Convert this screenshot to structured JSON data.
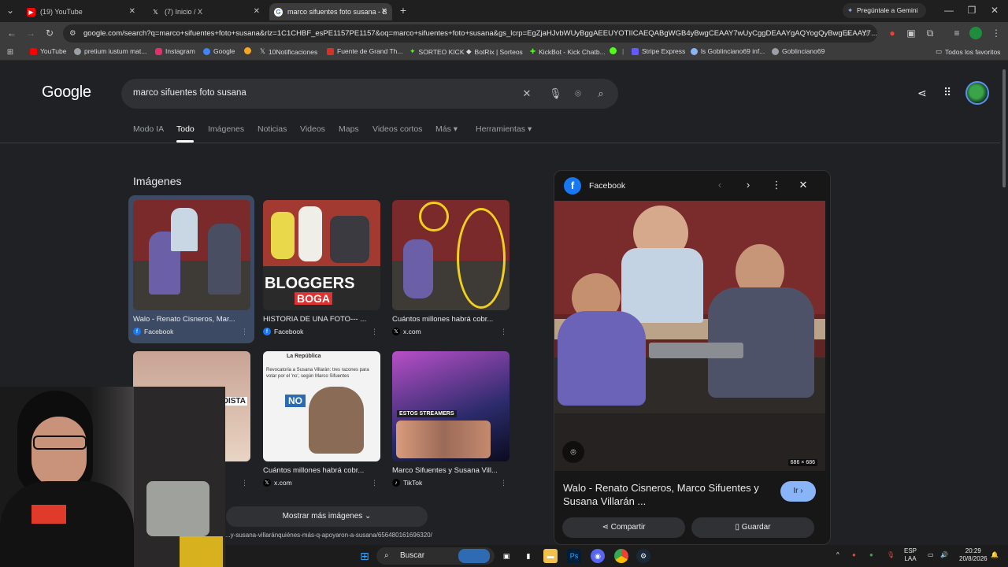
{
  "browser": {
    "tabs": [
      {
        "title": "(19) YouTube",
        "icon": "youtube-icon"
      },
      {
        "title": "(7) Inicio / X",
        "icon": "x-icon"
      },
      {
        "title": "marco sifuentes foto susana - B",
        "icon": "google-icon",
        "active": true
      }
    ],
    "gemini_button": "Pregúntale a Gemini",
    "url": "google.com/search?q=marco+sifuentes+foto+susana&rlz=1C1CHBF_esPE1157PE1157&oq=marco+sifuentes+foto+susana&gs_lcrp=EgZjaHJvbWUyBggAEEUYOTIICAEQABgWGB4yBwgCEAAY7wUyCggDEAAYgAQYogQyBwgEEAAY7...",
    "bookmarks": [
      {
        "label": "YouTube",
        "color": "#ff0000"
      },
      {
        "label": "pretium iustum mat...",
        "color": "#9aa0a6"
      },
      {
        "label": "Instagram",
        "color": "#e1306c"
      },
      {
        "label": "Google",
        "color": "#4285f4"
      },
      {
        "label": "",
        "color": "#f5a623"
      },
      {
        "label": "10Notificaciones",
        "color": "#e8eaed"
      },
      {
        "label": "Fuente de Grand Th...",
        "color": "#d93025"
      },
      {
        "label": "SORTEO KICK",
        "color": "#53fc18"
      },
      {
        "label": "BotRix | Sorteos",
        "color": "#e8eaed"
      },
      {
        "label": "KickBot - Kick Chatb...",
        "color": "#53fc18"
      },
      {
        "label": "",
        "color": "#53fc18"
      },
      {
        "label": "|",
        "color": "#3c3c3c"
      },
      {
        "label": "Stripe Express",
        "color": "#635bff"
      },
      {
        "label": "ls Goblinciano69 inf...",
        "color": "#8ab4f8"
      },
      {
        "label": "Goblinciano69",
        "color": "#9aa0a6"
      }
    ],
    "all_bookmarks": "Todos los favoritos"
  },
  "google": {
    "logo": "Google",
    "query": "marco sifuentes foto susana",
    "nav": [
      "Modo IA",
      "Todo",
      "Imágenes",
      "Noticias",
      "Videos",
      "Maps",
      "Videos cortos",
      "Más ▾",
      "Herramientas ▾"
    ],
    "active_nav": "Todo",
    "images_heading": "Imágenes",
    "results": [
      {
        "caption": "Walo - Renato Cisneros, Mar...",
        "source": "Facebook",
        "source_icon": "facebook-icon"
      },
      {
        "caption": "HISTORIA DE UNA FOTO--- ...",
        "source": "Facebook",
        "source_icon": "facebook-icon"
      },
      {
        "caption": "Cuántos millones habrá cobr...",
        "source": "x.com",
        "source_icon": "x-icon"
      },
      {
        "caption": "...CO...",
        "source": "",
        "source_icon": ""
      },
      {
        "caption": "Cuántos millones habrá cobr...",
        "source": "x.com",
        "source_icon": "x-icon"
      },
      {
        "caption": "Marco Sifuentes y Susana Vill...",
        "source": "TikTok",
        "source_icon": "tiktok-icon"
      }
    ],
    "thumb_text": {
      "bloggers": "BLOGGERS",
      "boga": "BOGA",
      "republica": "La República",
      "tweet": "Revocatoria a Susana Villarán: tres razones para votar por el 'no', según Marco Sifuentes",
      "no": "NO",
      "streamers": "ESTOS STREAMERS",
      "odista": "ODISTA"
    },
    "more_images": "Mostrar más imágenes",
    "status_url": "...y-susana-villaránquiénes-más-q-apoyaron-a-susana/656480161696320/"
  },
  "preview": {
    "source": "Facebook",
    "title": "Walo - Renato Cisneros, Marco Sifuentes y Susana Villarán ...",
    "dimensions": "686 × 686",
    "go_button": "Ir",
    "share_button": "Compartir",
    "save_button": "Guardar"
  },
  "taskbar": {
    "search": "Buscar",
    "lang_top": "ESP",
    "lang_bottom": "LAA",
    "time": "20:29",
    "date": "20/8/2026"
  }
}
